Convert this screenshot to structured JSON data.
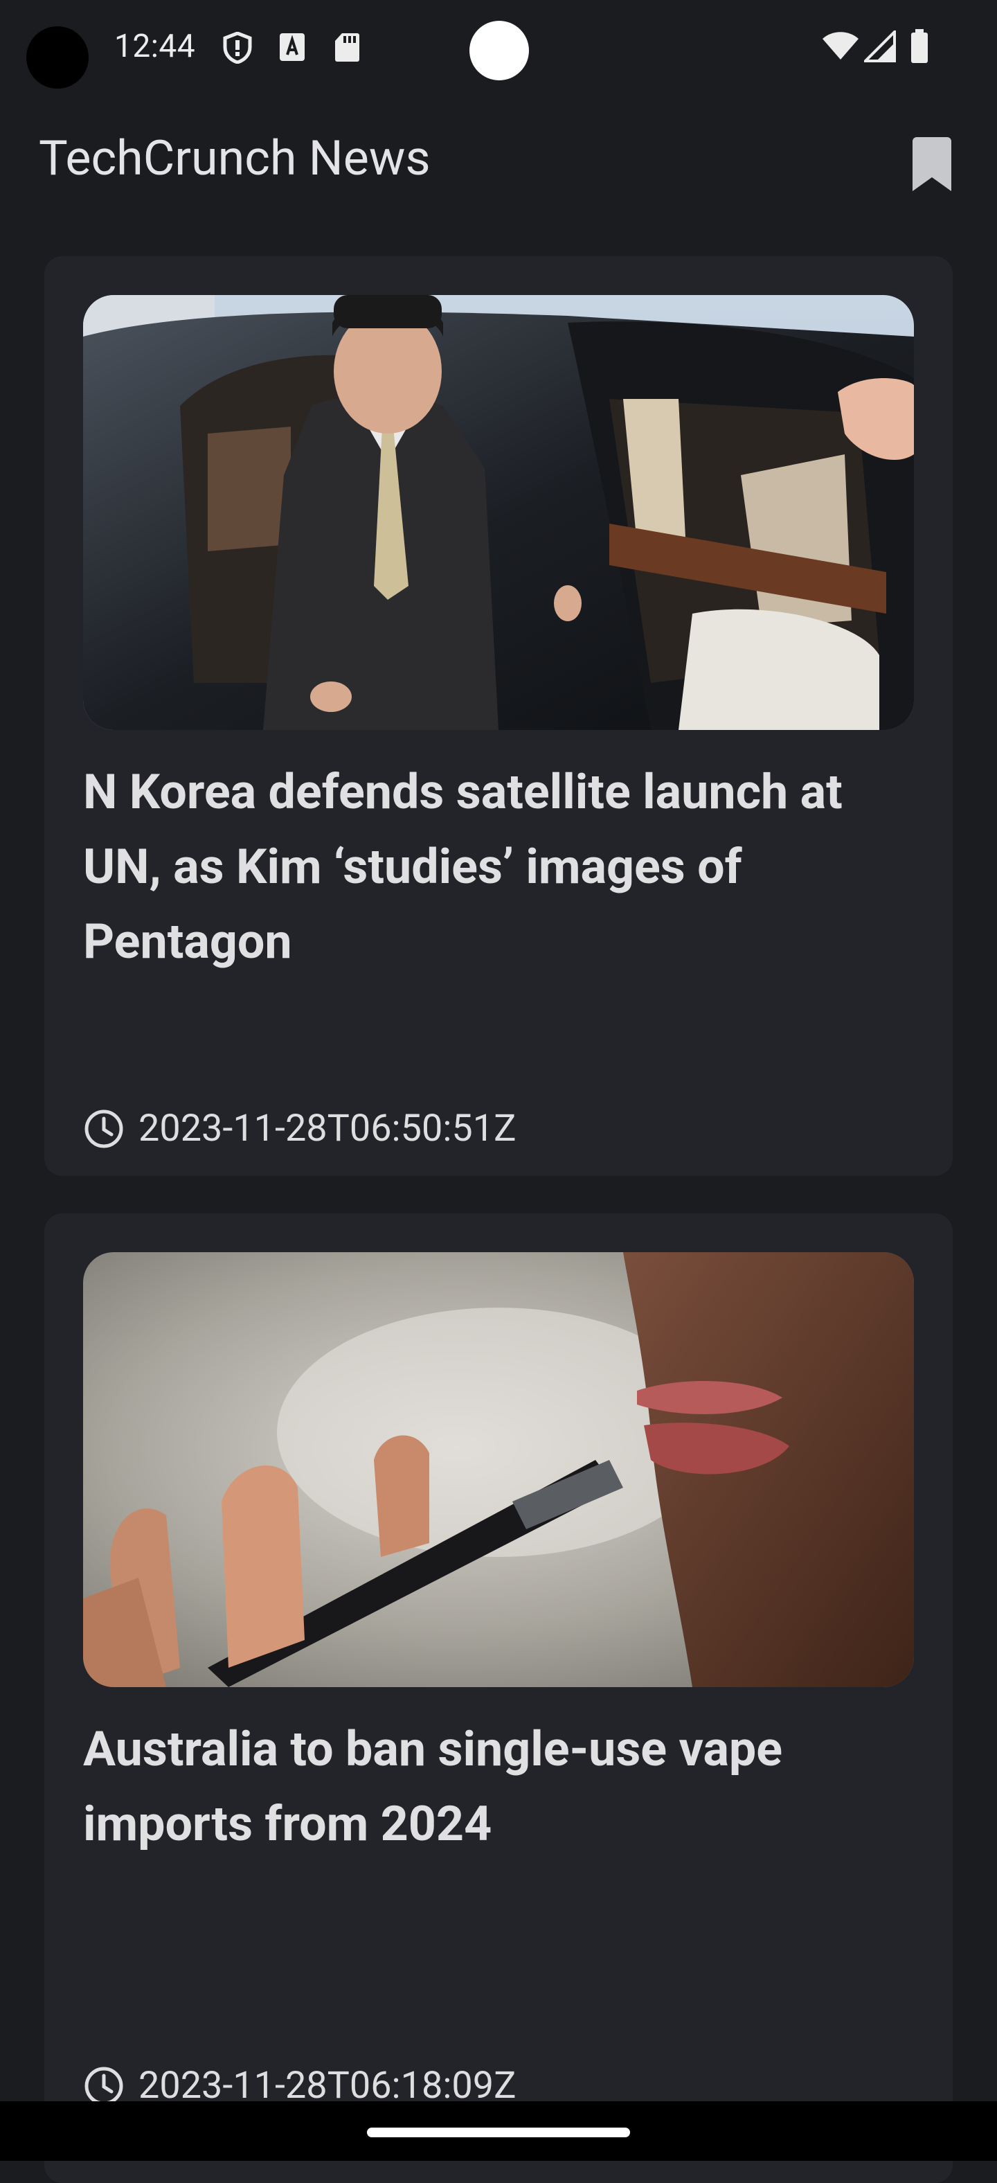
{
  "status_bar": {
    "time": "12:44",
    "icons": [
      "shield-icon",
      "font-a-icon",
      "sd-card-icon",
      "wifi-icon",
      "signal-icon",
      "battery-icon"
    ]
  },
  "app_bar": {
    "title": "TechCrunch News",
    "bookmark_icon": "bookmark-icon"
  },
  "articles": [
    {
      "title": "N Korea defends satellite launch at UN, as Kim ‘studies’ images of Pentagon",
      "published": "2023-11-28T06:50:51Z",
      "clock_icon": "clock-icon"
    },
    {
      "title": "Australia to ban single-use vape imports from 2024",
      "published": "2023-11-28T06:18:09Z",
      "clock_icon": "clock-icon"
    }
  ],
  "colors": {
    "background": "#1a1c20",
    "card": "#222429",
    "text": "#e0e0e2"
  }
}
